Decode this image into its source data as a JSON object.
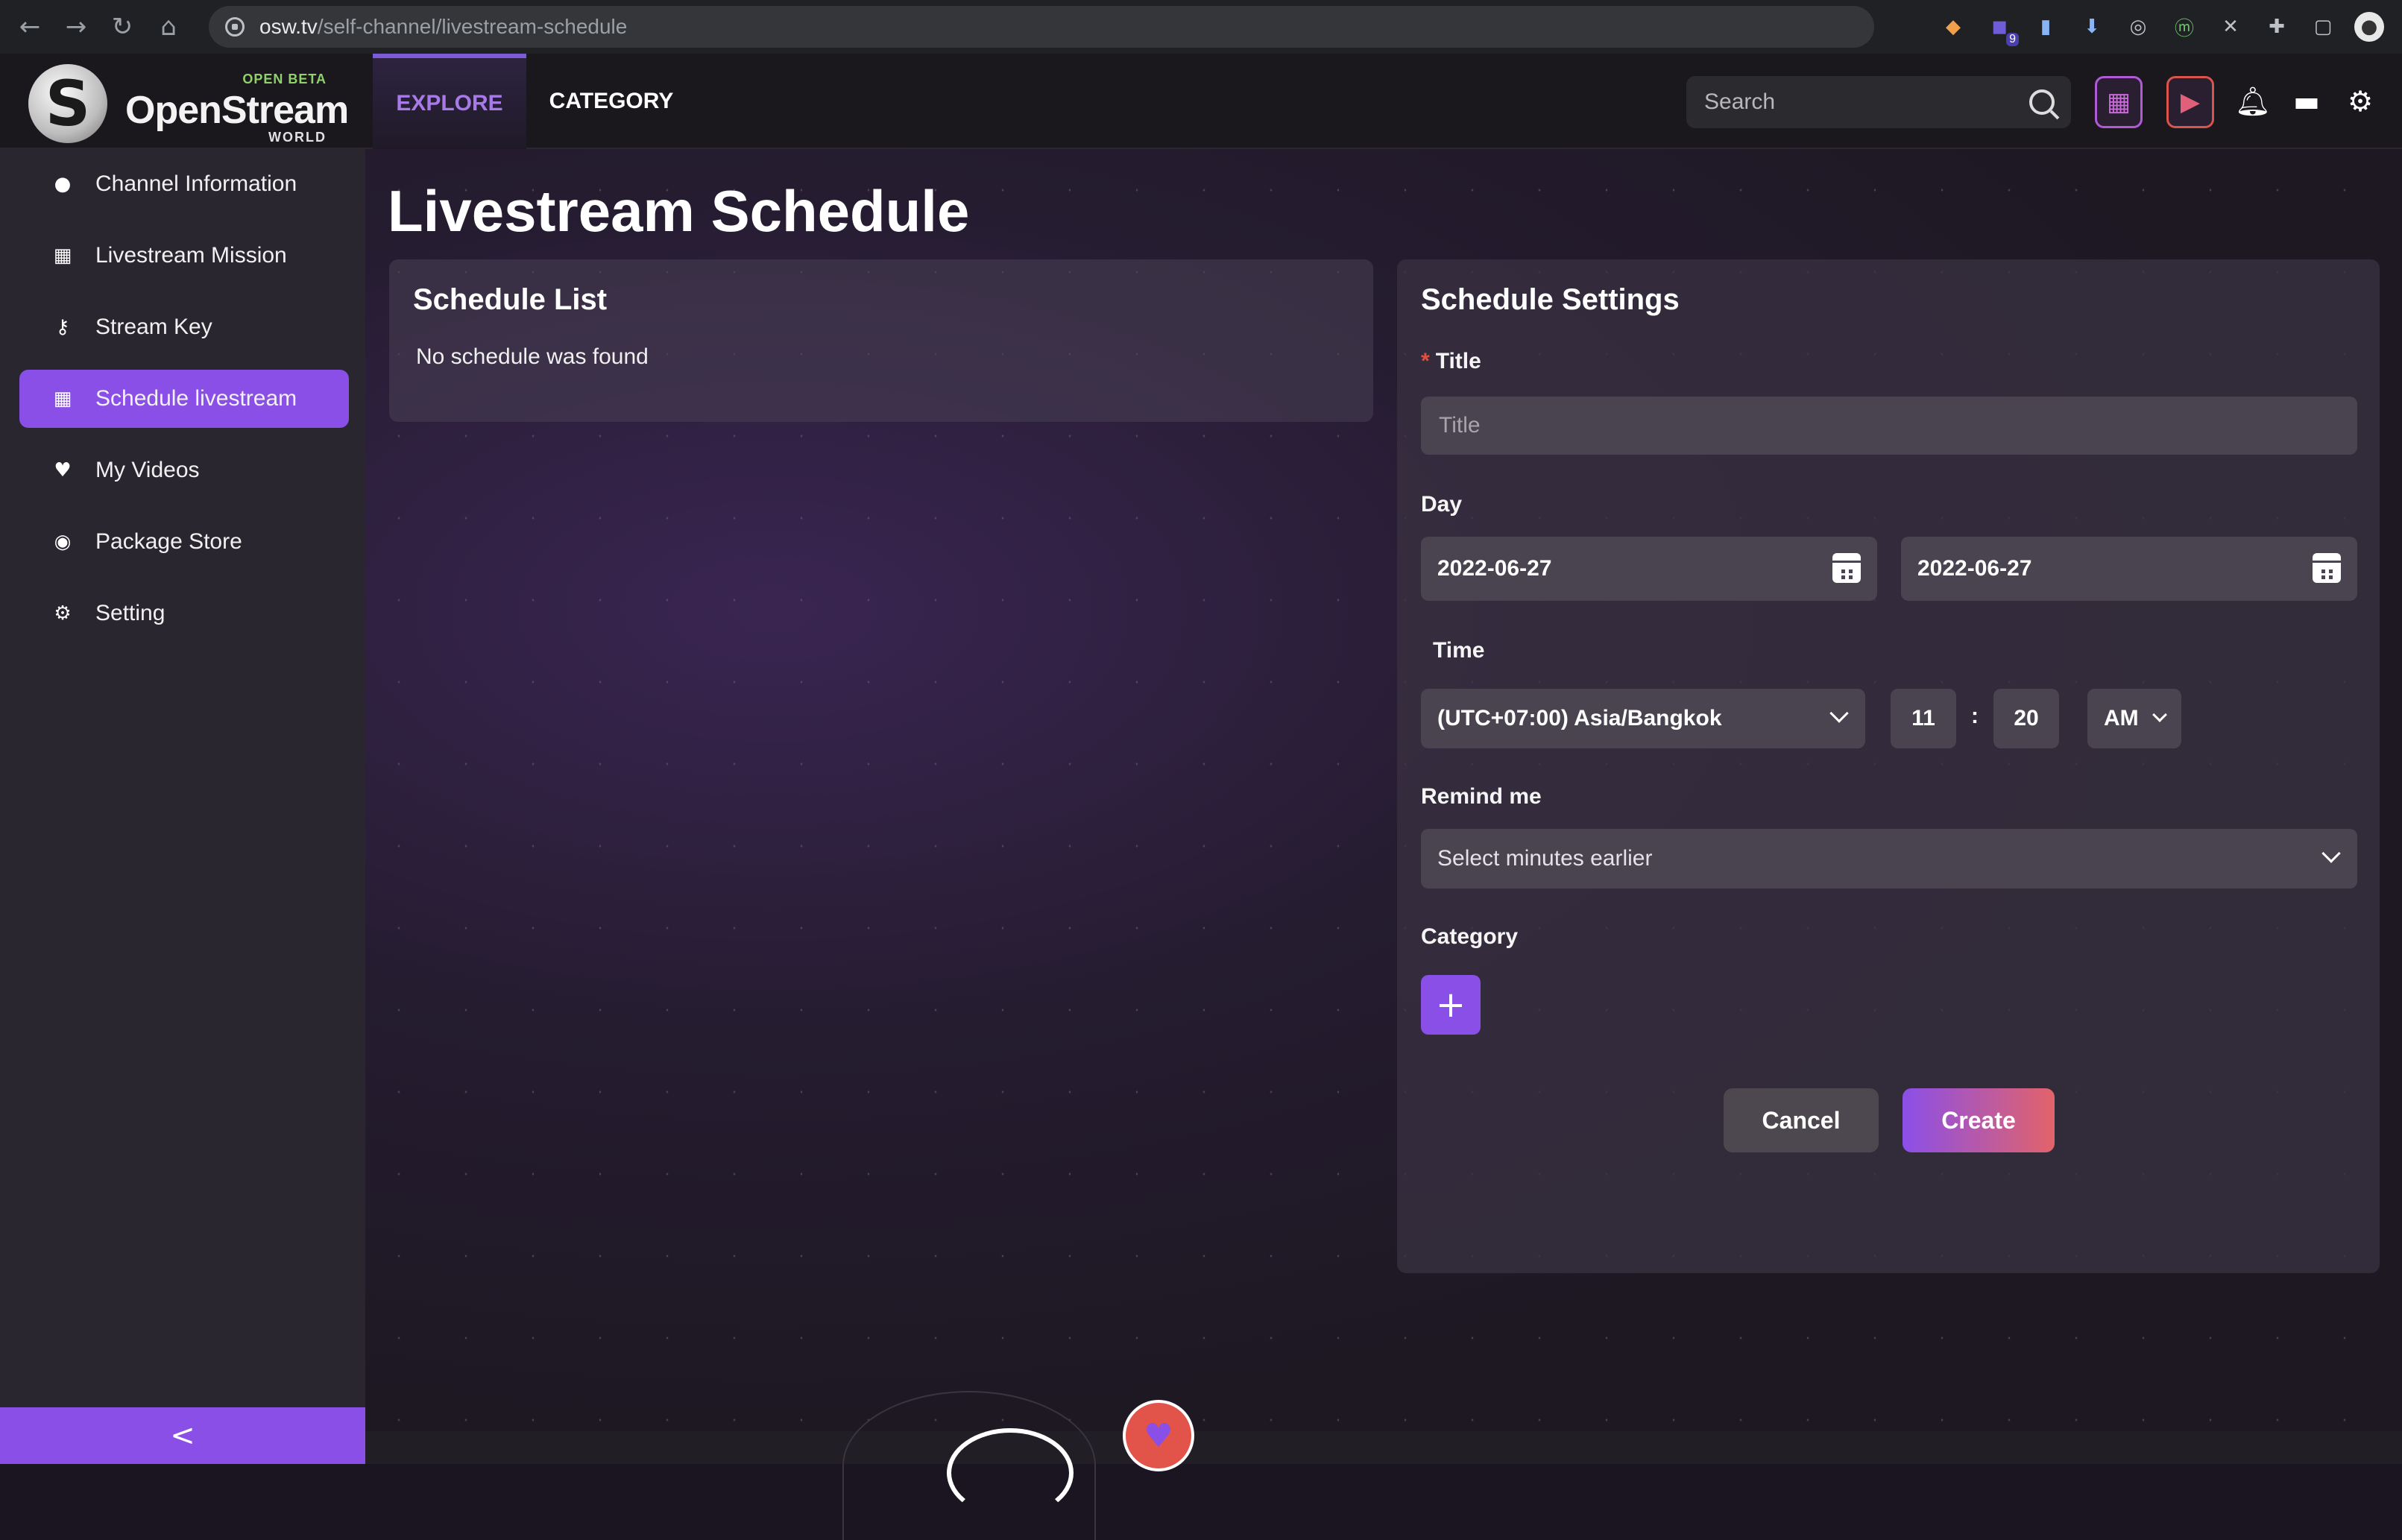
{
  "browser": {
    "url_host": "osw.tv",
    "url_path": "/self-channel/livestream-schedule",
    "nav": {
      "back": "←",
      "forward": "→",
      "reload": "↻",
      "home": "⌂"
    },
    "extensions": [
      "metamask-icon",
      "extension-badge-icon",
      "docs-icon",
      "download-icon",
      "circle-icon",
      "m-icon",
      "tools-icon",
      "puzzle-icon",
      "sidebar-icon",
      "profile-avatar"
    ],
    "extension_badge": "9"
  },
  "header": {
    "logo_beta": "OPEN BETA",
    "logo_name": "OpenStream",
    "logo_world": "WORLD",
    "tabs": [
      {
        "label": "EXPLORE",
        "active": true
      },
      {
        "label": "CATEGORY",
        "active": false
      }
    ],
    "search_placeholder": "Search",
    "accent": "#8a4fe6"
  },
  "sidebar": {
    "items": [
      {
        "label": "Channel Information",
        "icon": "user-icon",
        "active": false
      },
      {
        "label": "Livestream Mission",
        "icon": "calendar-icon",
        "active": false
      },
      {
        "label": "Stream Key",
        "icon": "key-icon",
        "active": false
      },
      {
        "label": "Schedule livestream",
        "icon": "calendar-icon",
        "active": true
      },
      {
        "label": "My Videos",
        "icon": "heart-icon",
        "active": false
      },
      {
        "label": "Package Store",
        "icon": "package-icon",
        "active": false
      },
      {
        "label": "Setting",
        "icon": "gear-icon",
        "active": false
      }
    ],
    "collapse": "<"
  },
  "main": {
    "title": "Livestream Schedule",
    "schedule_list": {
      "heading": "Schedule List",
      "empty": "No schedule was found"
    },
    "settings": {
      "heading": "Schedule Settings",
      "title_label": "Title",
      "title_placeholder": "Title",
      "day_label": "Day",
      "day_start": "2022-06-27",
      "day_end": "2022-06-27",
      "time_label": "Time",
      "timezone": "(UTC+07:00) Asia/Bangkok",
      "hour": "11",
      "minute": "20",
      "ampm": "AM",
      "remind_label": "Remind me",
      "remind_placeholder": "Select minutes earlier",
      "category_label": "Category",
      "add_symbol": "+",
      "cancel": "Cancel",
      "create": "Create"
    }
  }
}
